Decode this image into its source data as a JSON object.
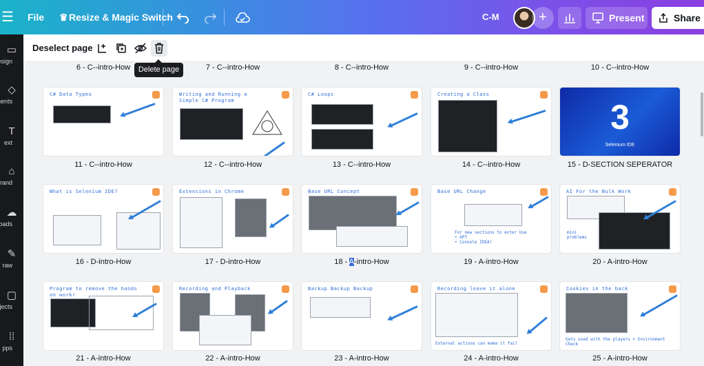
{
  "topbar": {
    "menu_icon": "hamburger-icon",
    "file_label": "File",
    "resize_label": "Resize & Magic Switch",
    "undo_icon": "undo-icon",
    "redo_icon": "redo-icon",
    "cloud_icon": "cloud-check-icon",
    "user_initials": "C-M",
    "add_icon": "plus-icon",
    "stats_icon": "bar-chart-icon",
    "present_label": "Present",
    "share_label": "Share"
  },
  "rail": {
    "items": [
      {
        "label": "esign",
        "icon": "design-icon"
      },
      {
        "label": "ements",
        "icon": "elements-icon"
      },
      {
        "label": "ext",
        "icon": "text-icon"
      },
      {
        "label": "rand",
        "icon": "brand-icon"
      },
      {
        "label": "oads",
        "icon": "uploads-icon"
      },
      {
        "label": "raw",
        "icon": "draw-icon"
      },
      {
        "label": "ojects",
        "icon": "projects-icon"
      },
      {
        "label": "pps",
        "icon": "apps-icon"
      }
    ]
  },
  "toolbar": {
    "deselect_label": "Deselect page",
    "tooltip": "Delete page"
  },
  "top_captions": [
    "6 - C--intro-How",
    "7 - C--intro-How",
    "8 - C--intro-How",
    "9 - C--intro-How",
    "10 - C--intro-How"
  ],
  "pages": [
    {
      "caption": "11 - C--intro-How",
      "title": "C# Data Types"
    },
    {
      "caption": "12 - C--intro-How",
      "title": "Writing and Running a Simple C# Program"
    },
    {
      "caption": "13 - C--intro-How",
      "title": "C# Loops"
    },
    {
      "caption": "14 - C--intro-How",
      "title": "Creating a Class"
    },
    {
      "caption": "15 - D-SECTION SEPERATOR",
      "title": "3",
      "subtitle": "Selenium IDE"
    },
    {
      "caption": "16 - D-intro-How",
      "title": "What is Selenium IDE?"
    },
    {
      "caption": "17 - D-intro-How",
      "title": "Extensions in Chrome"
    },
    {
      "caption_pre": "18 - ",
      "caption_hl": "A",
      "caption_post": "-intro-How",
      "title": "Base URL Concept"
    },
    {
      "caption": "19 - A-intro-How",
      "title": "Base URL Change",
      "note": "For new sections to enter Use\n• GPT\n• Console IDEA!"
    },
    {
      "caption": "20 - A-intro-How",
      "title": "AI For the Bulk Work",
      "note": "mini\nproblems"
    },
    {
      "caption": "21 - A-intro-How",
      "title": "Program to remove the hands on work!"
    },
    {
      "caption": "22 - A-intro-How",
      "title": "Recording and Playback"
    },
    {
      "caption": "23 - A-intro-How",
      "title": "Backup Backup Backup"
    },
    {
      "caption": "24 - A-intro-How",
      "title": "Recording leave it alone",
      "note": "External actions can make it fail"
    },
    {
      "caption": "25 - A-intro-How",
      "title": "Cookies in the back",
      "note": "Gets used with the players > Environment Check"
    }
  ],
  "colors": {
    "accent": "#2d6bd8",
    "badge": "#f59a4a",
    "rail_bg": "#18191b"
  }
}
